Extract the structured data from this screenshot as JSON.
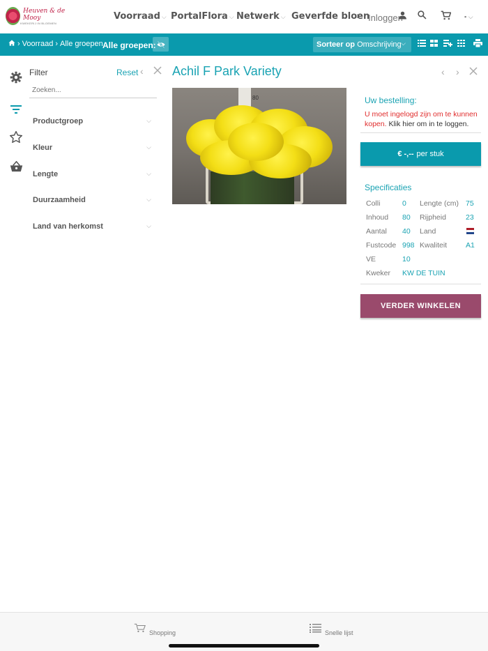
{
  "header": {
    "logo_text": "Heuven & de Mooy",
    "logo_sub": "KWEKERIJ IN BLOEMEN",
    "nav": [
      {
        "label": "Voorraad"
      },
      {
        "label": "PortalFlora"
      },
      {
        "label": "Netwerk"
      },
      {
        "label": "Geverfde bloen"
      }
    ],
    "nav_more": "›",
    "login_label": "Inloggen"
  },
  "toolbar": {
    "crumbs": [
      "Voorraad",
      "Alle groepen"
    ],
    "group_label": "Alle groepen:",
    "sort_prefix": "Sorteer op",
    "sort_value": "Omschrijving"
  },
  "filter": {
    "title": "Filter",
    "reset": "Reset",
    "search_placeholder": "Zoeken...",
    "groups": [
      "Productgroep",
      "Kleur",
      "Lengte",
      "Duurzaamheid",
      "Land van herkomst"
    ]
  },
  "product": {
    "title": "Achil F Park Variety",
    "ruler_label": "80"
  },
  "order": {
    "title": "Uw bestelling:",
    "message_red": "U moet ingelogd zijn om te kunnen kopen.",
    "message_dark": "Klik hier om in te loggen.",
    "price": "€ -,--",
    "price_unit": "per stuk"
  },
  "specs": {
    "title": "Specificaties",
    "left": [
      {
        "label": "Colli",
        "value": "0"
      },
      {
        "label": "Inhoud",
        "value": "80"
      },
      {
        "label": "Aantal",
        "value": "40"
      },
      {
        "label": "Fustcode",
        "value": "998"
      },
      {
        "label": "VE",
        "value": "10"
      },
      {
        "label": "Kweker",
        "value": "KW DE TUIN"
      }
    ],
    "right": [
      {
        "label": "Lengte (cm)",
        "value": "75"
      },
      {
        "label": "Rijpheid",
        "value": "23"
      },
      {
        "label": "Land",
        "value": ""
      },
      {
        "label": "Kwaliteit",
        "value": "A1"
      }
    ],
    "flag_colors": [
      "#ae1c28",
      "#ffffff",
      "#21468b"
    ]
  },
  "continue_label": "VERDER WINKELEN",
  "footer": {
    "tabs": [
      {
        "label": "Shopping",
        "icon": "cart-icon"
      },
      {
        "label": "Snelle lijst",
        "icon": "list-icon"
      }
    ]
  },
  "colors": {
    "accent": "#0a9aad",
    "continue": "#9a4a6c",
    "error": "#e02d2d"
  }
}
